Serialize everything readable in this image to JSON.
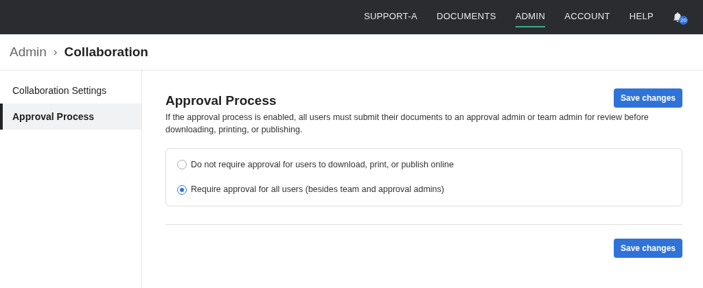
{
  "nav": {
    "items": [
      {
        "label": "SUPPORT-A",
        "selected": false
      },
      {
        "label": "DOCUMENTS",
        "selected": false
      },
      {
        "label": "ADMIN",
        "selected": true
      },
      {
        "label": "ACCOUNT",
        "selected": false
      },
      {
        "label": "HELP",
        "selected": false
      }
    ],
    "notifications": {
      "count": "20"
    }
  },
  "breadcrumb": {
    "parent": "Admin",
    "separator": "›",
    "current": "Collaboration"
  },
  "sidebar": {
    "items": [
      {
        "label": "Collaboration Settings",
        "selected": false
      },
      {
        "label": "Approval Process",
        "selected": true
      }
    ]
  },
  "section": {
    "title": "Approval Process",
    "description": "If the approval process is enabled, all users must submit their documents to an approval admin or team admin for review before downloading, printing, or publishing.",
    "options": [
      {
        "label": "Do not require approval for users to download, print, or publish online",
        "selected": false
      },
      {
        "label": "Require approval for all users (besides team and approval admins)",
        "selected": true
      }
    ]
  },
  "buttons": {
    "top": "Save changes",
    "bottom": "Save changes"
  }
}
